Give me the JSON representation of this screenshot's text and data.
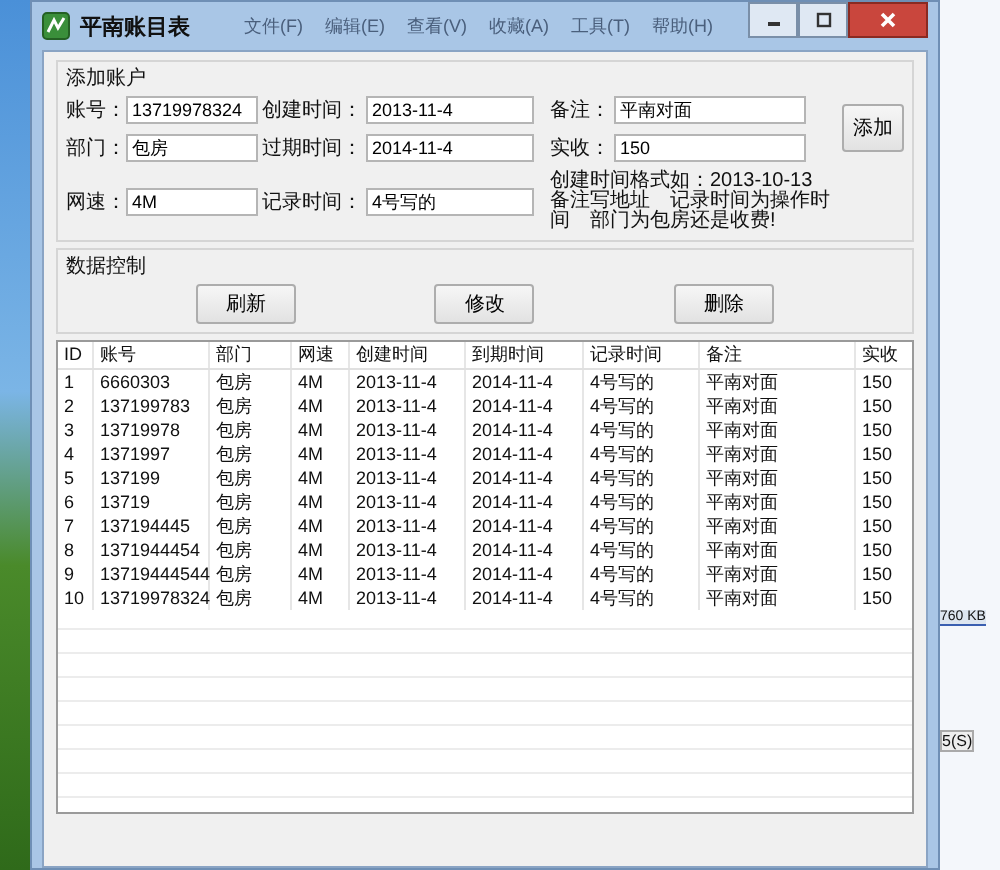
{
  "background_window": {
    "menu": [
      "文件(F)",
      "编辑(E)",
      "查看(V)",
      "收藏(A)",
      "工具(T)",
      "帮助(H)"
    ],
    "size": "760 KB",
    "button": "5(S)"
  },
  "window": {
    "title": "平南账目表"
  },
  "add_group": {
    "title": "添加账户",
    "fields": [
      {
        "label": "账号：",
        "value": "13719978324"
      },
      {
        "label": "创建时间：",
        "value": "2013-11-4"
      },
      {
        "label": "备注：",
        "value": "平南对面"
      },
      {
        "label": "部门：",
        "value": "包房"
      },
      {
        "label": "过期时间：",
        "value": "2014-11-4"
      },
      {
        "label": "实收：",
        "value": "150"
      },
      {
        "label": "网速：",
        "value": "4M"
      },
      {
        "label": "记录时间：",
        "value": "4号写的"
      }
    ],
    "note": "创建时间格式如：2013-10-13　备注写地址　记录时间为操作时间　部门为包房还是收费!",
    "add_button": "添加"
  },
  "data_group": {
    "title": "数据控制",
    "buttons": [
      "刷新",
      "修改",
      "删除"
    ]
  },
  "table": {
    "columns": [
      "ID",
      "账号",
      "部门",
      "网速",
      "创建时间",
      "到期时间",
      "记录时间",
      "备注",
      "实收"
    ],
    "rows": [
      [
        "1",
        "6660303",
        "包房",
        "4M",
        "2013-11-4",
        "2014-11-4",
        "4号写的",
        "平南对面",
        "150"
      ],
      [
        "2",
        "137199783",
        "包房",
        "4M",
        "2013-11-4",
        "2014-11-4",
        "4号写的",
        "平南对面",
        "150"
      ],
      [
        "3",
        "13719978",
        "包房",
        "4M",
        "2013-11-4",
        "2014-11-4",
        "4号写的",
        "平南对面",
        "150"
      ],
      [
        "4",
        "1371997",
        "包房",
        "4M",
        "2013-11-4",
        "2014-11-4",
        "4号写的",
        "平南对面",
        "150"
      ],
      [
        "5",
        "137199",
        "包房",
        "4M",
        "2013-11-4",
        "2014-11-4",
        "4号写的",
        "平南对面",
        "150"
      ],
      [
        "6",
        "13719",
        "包房",
        "4M",
        "2013-11-4",
        "2014-11-4",
        "4号写的",
        "平南对面",
        "150"
      ],
      [
        "7",
        "137194445",
        "包房",
        "4M",
        "2013-11-4",
        "2014-11-4",
        "4号写的",
        "平南对面",
        "150"
      ],
      [
        "8",
        "1371944454",
        "包房",
        "4M",
        "2013-11-4",
        "2014-11-4",
        "4号写的",
        "平南对面",
        "150"
      ],
      [
        "9",
        "13719444544",
        "包房",
        "4M",
        "2013-11-4",
        "2014-11-4",
        "4号写的",
        "平南对面",
        "150"
      ],
      [
        "10",
        "13719978324",
        "包房",
        "4M",
        "2013-11-4",
        "2014-11-4",
        "4号写的",
        "平南对面",
        "150"
      ]
    ]
  }
}
